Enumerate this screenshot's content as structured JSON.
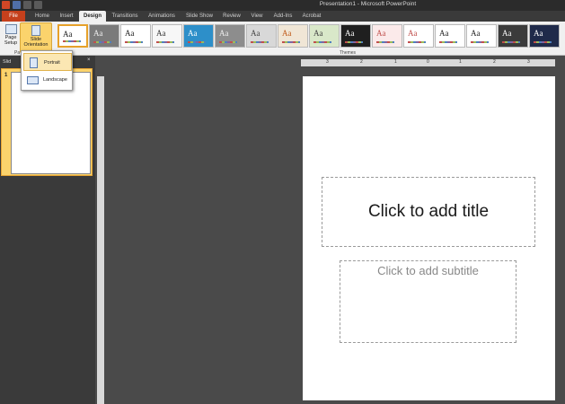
{
  "window": {
    "title": "Presentation1 - Microsoft PowerPoint"
  },
  "tabs": [
    {
      "label": "File"
    },
    {
      "label": "Home"
    },
    {
      "label": "Insert"
    },
    {
      "label": "Design"
    },
    {
      "label": "Transitions"
    },
    {
      "label": "Animations"
    },
    {
      "label": "Slide Show"
    },
    {
      "label": "Review"
    },
    {
      "label": "View"
    },
    {
      "label": "Add-Ins"
    },
    {
      "label": "Acrobat"
    }
  ],
  "ribbon": {
    "page_setup": "Page Setup",
    "slide_orientation": "Slide Orientation",
    "page_group": "Pa",
    "themes_group": "Themes"
  },
  "themes": [
    {
      "aa": "Aa",
      "bg": "#ffffff",
      "fg": "#222222"
    },
    {
      "aa": "Aa",
      "bg": "#7a7a7a",
      "fg": "#eeeeee"
    },
    {
      "aa": "Aa",
      "bg": "#ffffff",
      "fg": "#222222"
    },
    {
      "aa": "Aa",
      "bg": "#f7f7f7",
      "fg": "#333333"
    },
    {
      "aa": "Aa",
      "bg": "#2d8fc9",
      "fg": "#ffffff"
    },
    {
      "aa": "Aa",
      "bg": "#8d8d8d",
      "fg": "#eeeeee"
    },
    {
      "aa": "Aa",
      "bg": "#d8d8d8",
      "fg": "#444444"
    },
    {
      "aa": "Aa",
      "bg": "#f0e6d6",
      "fg": "#c05a1a"
    },
    {
      "aa": "Aa",
      "bg": "#d9e8c9",
      "fg": "#444444"
    },
    {
      "aa": "Aa",
      "bg": "#1f1f1f",
      "fg": "#ffffff"
    },
    {
      "aa": "Aa",
      "bg": "#fbeaea",
      "fg": "#c0504d"
    },
    {
      "aa": "Aa",
      "bg": "#ffffff",
      "fg": "#c0504d"
    },
    {
      "aa": "Aa",
      "bg": "#ffffff",
      "fg": "#222222"
    },
    {
      "aa": "Aa",
      "bg": "#ffffff",
      "fg": "#222222"
    },
    {
      "aa": "Aa",
      "bg": "#3b3b3b",
      "fg": "#ffffff"
    },
    {
      "aa": "Aa",
      "bg": "#1f2a4a",
      "fg": "#ffffff"
    }
  ],
  "orientation_menu": {
    "portrait": "Portrait",
    "landscape": "Landscape"
  },
  "panel": {
    "tab_label": "Slid",
    "close": "×",
    "slide_number": "1"
  },
  "ruler": {
    "ticks": [
      "3",
      "2",
      "1",
      "0",
      "1",
      "2",
      "3"
    ]
  },
  "slide": {
    "title_placeholder": "Click to add title",
    "subtitle_placeholder": "Click to add subtitle"
  }
}
